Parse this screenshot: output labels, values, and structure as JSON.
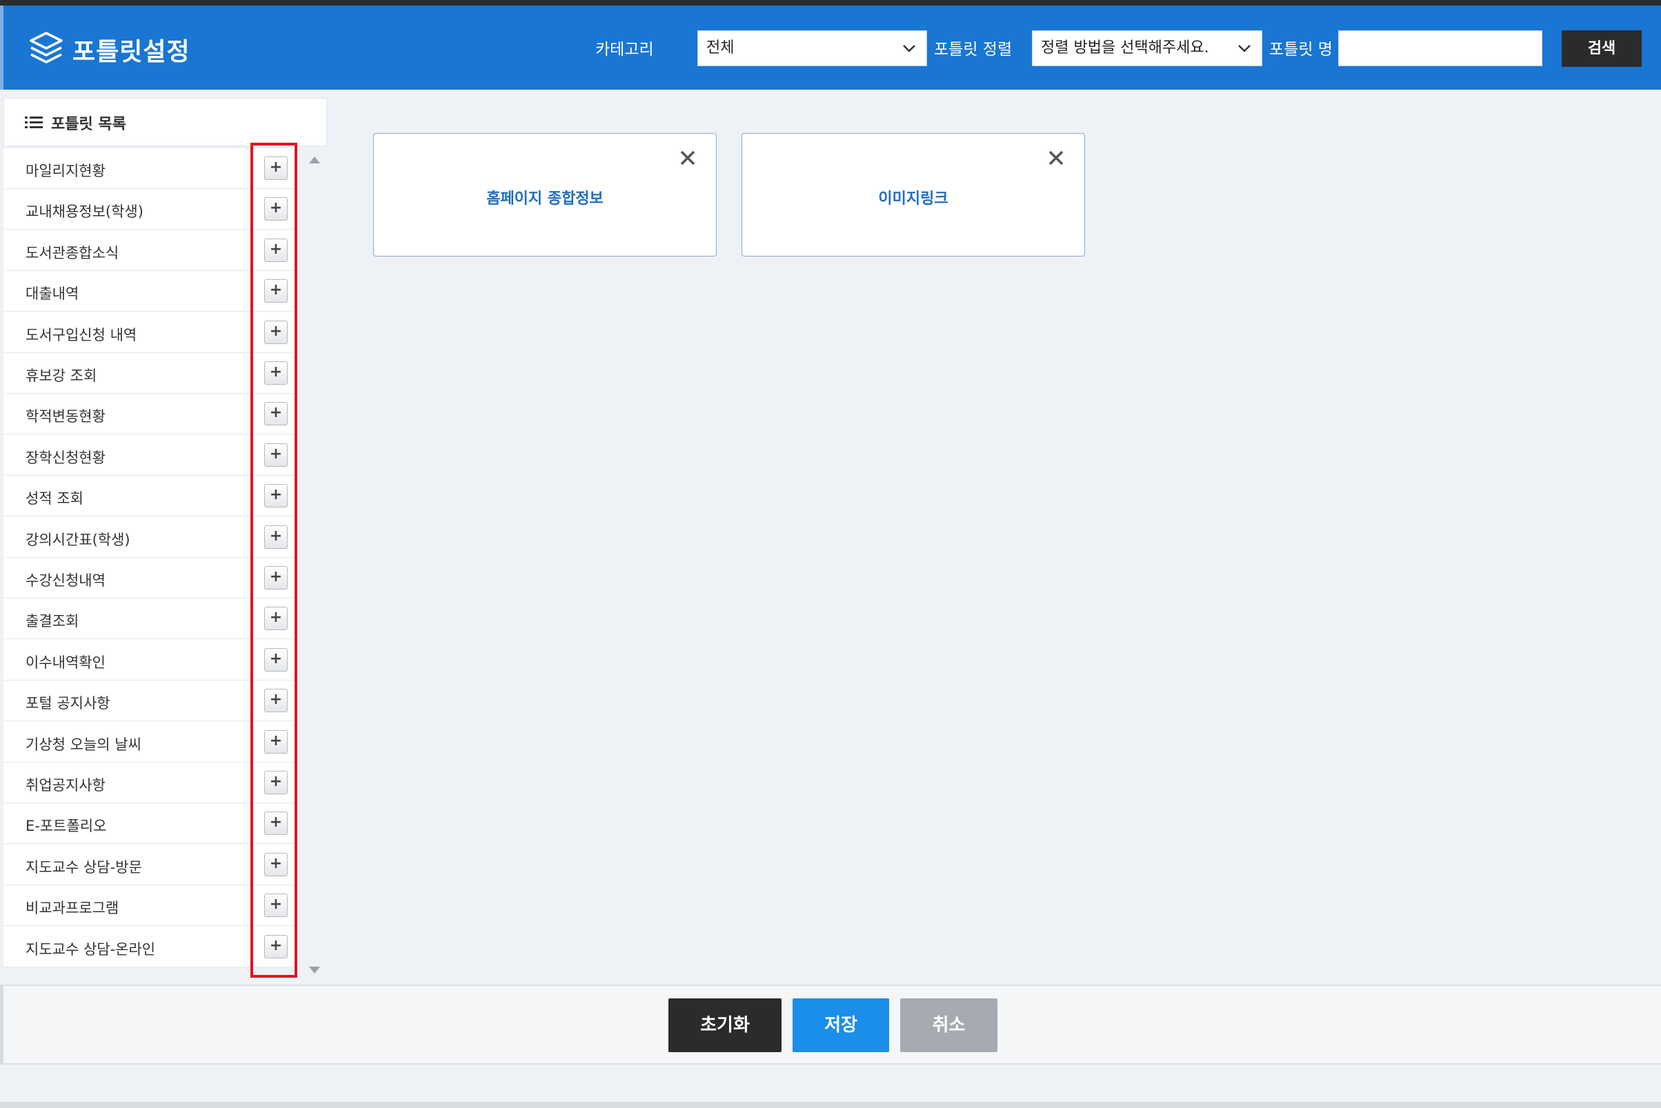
{
  "header": {
    "title": "포틀릿설정",
    "category_label": "카테고리",
    "category_value": "전체",
    "sort_label": "포틀릿 정렬",
    "sort_value": "정렬 방법을 선택해주세요.",
    "name_label": "포틀릿 명",
    "name_value": "",
    "search_label": "검색"
  },
  "panel": {
    "title": "포틀릿 목록",
    "add_symbol": "+",
    "items": [
      {
        "label": "마일리지현황"
      },
      {
        "label": "교내채용정보(학생)"
      },
      {
        "label": "도서관종합소식"
      },
      {
        "label": "대출내역"
      },
      {
        "label": "도서구입신청 내역"
      },
      {
        "label": "휴보강 조회"
      },
      {
        "label": "학적변동현황"
      },
      {
        "label": "장학신청현황"
      },
      {
        "label": "성적 조회"
      },
      {
        "label": "강의시간표(학생)"
      },
      {
        "label": "수강신청내역"
      },
      {
        "label": "출결조회"
      },
      {
        "label": "이수내역확인"
      },
      {
        "label": "포털 공지사항"
      },
      {
        "label": "기상청 오늘의 날씨"
      },
      {
        "label": "취업공지사항"
      },
      {
        "label": "E-포트폴리오"
      },
      {
        "label": "지도교수 상담-방문"
      },
      {
        "label": "비교과프로그램"
      },
      {
        "label": "지도교수 상담-온라인"
      }
    ]
  },
  "cards": [
    {
      "title": "홈페이지 종합정보"
    },
    {
      "title": "이미지링크"
    }
  ],
  "footer": {
    "reset_label": "초기화",
    "save_label": "저장",
    "cancel_label": "취소"
  },
  "colors": {
    "header_bg": "#1976d2",
    "save": "#1a8ee8",
    "reset": "#2b2b2b",
    "cancel": "#a7abb1",
    "highlight": "#e0161f"
  }
}
